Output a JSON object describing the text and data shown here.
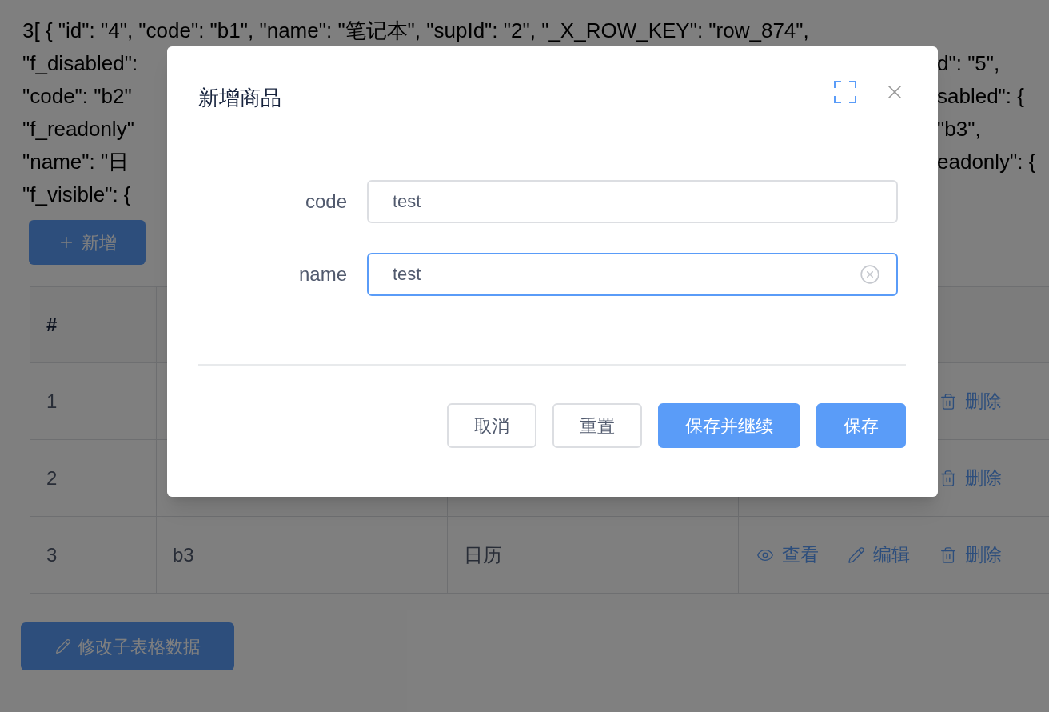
{
  "background_text": {
    "lines": [
      {
        "left": "3[ { \"id\": \"4\", \"code\": \"b1\", \"name\": \"笔记本\", \"supId\": \"2\", \"_X_ROW_KEY\": \"row_874\","
      },
      {
        "left": "\"f_disabled\":",
        "right": "d\": \"5\","
      },
      {
        "left": "\"code\": \"b2\"",
        "right": "sabled\": {"
      },
      {
        "left": "\"f_readonly\"",
        "right": "\"b3\","
      },
      {
        "left": "\"name\": \"日",
        "right": "eadonly\": {"
      },
      {
        "left": "\"f_visible\": {"
      }
    ]
  },
  "add_button": {
    "label": "新增"
  },
  "table": {
    "columns": [
      "#"
    ],
    "rows": [
      {
        "cells": [
          "1"
        ],
        "actions": [
          {
            "kind": "delete",
            "label": "删除"
          }
        ]
      },
      {
        "cells": [
          "2"
        ],
        "actions": [
          {
            "kind": "delete",
            "label": "删除"
          }
        ]
      },
      {
        "cells": [
          "3",
          "b3",
          "日历"
        ],
        "actions": [
          {
            "kind": "view",
            "label": "查看"
          },
          {
            "kind": "edit",
            "label": "编辑"
          },
          {
            "kind": "delete",
            "label": "删除"
          }
        ]
      }
    ]
  },
  "bottom_button": {
    "label": "修改子表格数据"
  },
  "dialog": {
    "title": "新增商品",
    "fields": [
      {
        "label": "code",
        "value": "test",
        "focused": false
      },
      {
        "label": "name",
        "value": "test",
        "focused": true
      }
    ],
    "buttons": [
      {
        "label": "取消",
        "kind": "default"
      },
      {
        "label": "重置",
        "kind": "default"
      },
      {
        "label": "保存并继续",
        "kind": "primary"
      },
      {
        "label": "保存",
        "kind": "primary"
      }
    ]
  }
}
